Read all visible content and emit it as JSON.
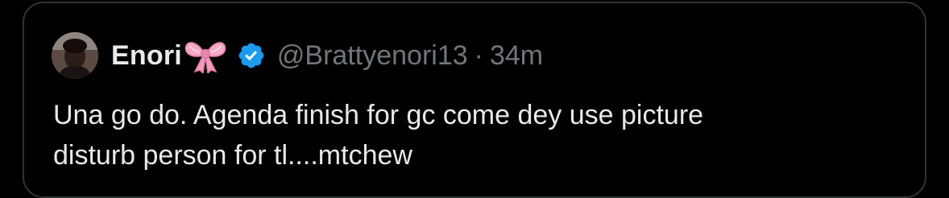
{
  "colors": {
    "background": "#000000",
    "border": "#2f3336",
    "primary_text": "#e7e9ea",
    "secondary_text": "#71767b",
    "verified_blue": "#1d9bf0",
    "bow_pink": "#f6a8c6"
  },
  "icons": {
    "bow": "pink-ribbon-bow-emoji",
    "verified": "blue-verified-badge"
  },
  "quote": {
    "display_name": "Enori",
    "handle": "@Brattyenori13",
    "separator": "·",
    "time": "34m",
    "text": "Una go do. Agenda finish for gc come dey use picture\ndisturb person for tl....mtchew"
  }
}
